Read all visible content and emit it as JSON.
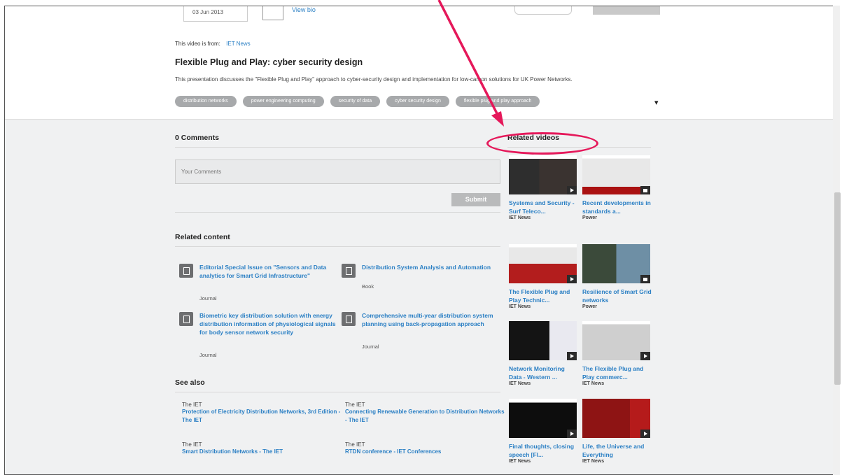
{
  "top": {
    "date": "03 Jun 2013",
    "view_link": "View bio",
    "from_label": "This video is from:",
    "from_link": "IET News",
    "title": "Flexible Plug and Play: cyber security design",
    "description": "This presentation discusses the \"Flexible Plug and Play\" approach to cyber-security design and implementation for low-carbon solutions for UK Power Networks.",
    "tags": [
      "distribution networks",
      "power engineering computing",
      "security of data",
      "cyber security design",
      "flexible plug and play approach"
    ],
    "chevron_icon": "chevron-down-icon"
  },
  "comments": {
    "heading": "0 Comments",
    "placeholder": "Your Comments",
    "submit_label": "Submit"
  },
  "related_content": {
    "heading": "Related content",
    "items": [
      {
        "title": "Editorial Special Issue on \"Sensors and Data analytics for Smart Grid Infrastructure\"",
        "type": "Journal",
        "icon": "journal-icon"
      },
      {
        "title": "Distribution System Analysis and Automation",
        "type": "Book",
        "icon": "book-icon"
      },
      {
        "title": "Biometric key distribution solution with energy distribution information of physiological signals for body sensor network security",
        "type": "Journal",
        "icon": "journal-icon"
      },
      {
        "title": "Comprehensive multi-year distribution system planning using back-propagation approach",
        "type": "Journal",
        "icon": "journal-icon"
      }
    ]
  },
  "see_also": {
    "heading": "See also",
    "items": [
      {
        "source": "The IET",
        "link": "Protection of Electricity Distribution Networks, 3rd Edition - The IET"
      },
      {
        "source": "The IET",
        "link": "Connecting Renewable Generation to Distribution Networks - The IET"
      },
      {
        "source": "The IET",
        "link": "Smart Distribution Networks - The IET"
      },
      {
        "source": "The IET",
        "link": "RTDN conference - IET Conferences"
      }
    ]
  },
  "related_videos": {
    "heading": "Related videos",
    "items": [
      {
        "title": "Systems and Security - Surf Teleco...",
        "source": "IET News",
        "locked": false
      },
      {
        "title": "Recent developments in standards a...",
        "source": "Power",
        "locked": true
      },
      {
        "title": "The Flexible Plug and Play Technic...",
        "source": "IET News",
        "locked": false
      },
      {
        "title": "Resilience of Smart Grid networks",
        "source": "Power",
        "locked": true
      },
      {
        "title": "Network Monitoring Data - Western ...",
        "source": "IET News",
        "locked": false
      },
      {
        "title": "The Flexible Plug and Play commerc...",
        "source": "IET News",
        "locked": false
      },
      {
        "title": "Final thoughts, closing speech [Fl...",
        "source": "IET News",
        "locked": false
      },
      {
        "title": "Life, the Universe and Everything",
        "source": "IET News",
        "locked": false
      }
    ]
  },
  "annotation": {
    "color": "#e5185a"
  },
  "colors": {
    "link": "#2a7fc4",
    "tag": "#a7a9ab",
    "page_bg": "#f0f1f2"
  }
}
